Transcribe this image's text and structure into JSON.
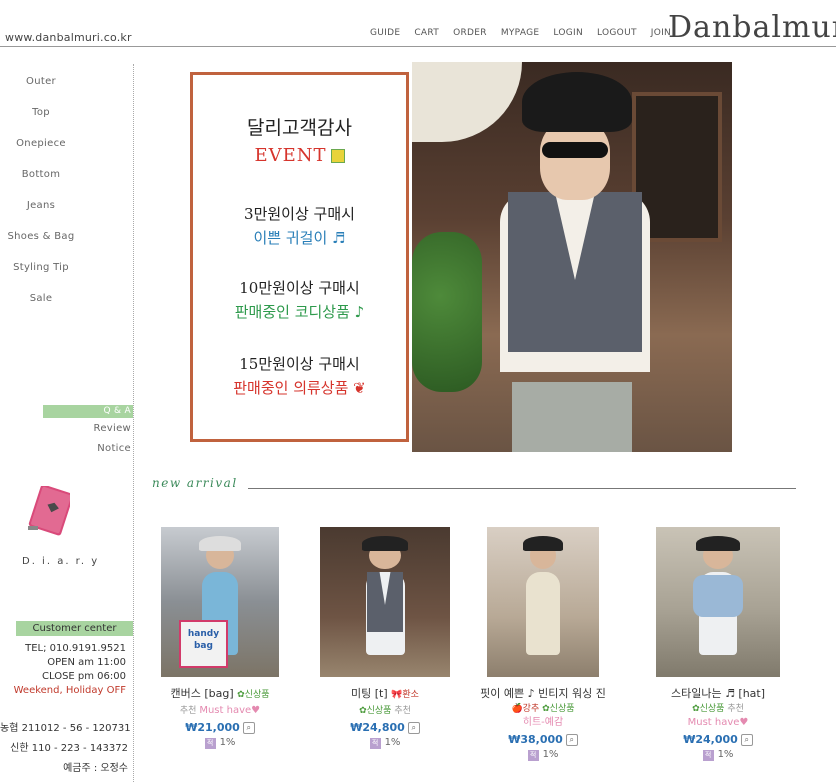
{
  "header": {
    "site_url": "www.danbalmuri.co.kr",
    "logo": "Danbalmuri",
    "nav": [
      "GUIDE",
      "CART",
      "ORDER",
      "MYPAGE",
      "LOGIN",
      "LOGOUT",
      "JOIN"
    ]
  },
  "sidebar": {
    "categories": [
      "Outer",
      "Top",
      "Onepiece",
      "Bottom",
      "Jeans",
      "Shoes & Bag",
      "Styling Tip",
      "Sale"
    ],
    "board": [
      "Q & A",
      "Review",
      "Notice"
    ],
    "diary_label": "D. i. a. r. y",
    "customer_center": {
      "title": "Customer center",
      "tel": "TEL; 010.9191.9521",
      "open": "OPEN am 11:00",
      "close": "CLOSE pm 06:00",
      "holiday": "Weekend, Holiday OFF"
    },
    "bank": {
      "line1": "농협 211012 - 56 - 120731",
      "line2": "신한 110 - 223 - 143372",
      "holder": "예금주 : 오정수"
    }
  },
  "event": {
    "title": "달리고객감사",
    "event": "EVENT",
    "tier1": "3만원이상 구매시",
    "gift1": "이쁜 귀걸이 ♬",
    "tier2": "10만원이상 구매시",
    "gift2": "판매중인 코디상품 ♪",
    "tier3": "15만원이상 구매시",
    "gift3": "판매중인 의류상품 ❦"
  },
  "new_arrival": {
    "title": "new arrival",
    "products": [
      {
        "name": "캔버스 [bag]",
        "tag1": "✿신상품",
        "tag2": "추천",
        "tag3": "Must have♥",
        "price": "₩21,000",
        "point": "1%"
      },
      {
        "name": "미팅 [t]",
        "tag_bow": "🎀환소",
        "tag1": "✿신상품",
        "tag2": "추천",
        "price": "₩24,800",
        "point": "1%"
      },
      {
        "name": "핏이 예쁜 ♪ 빈티지 워싱 진",
        "tag_bow": "🍎강추",
        "tag1": "✿신상품",
        "tag2": "히트-예감",
        "price": "₩38,000",
        "point": "1%"
      },
      {
        "name": "스타일나는 ♬ [hat]",
        "tag1": "✿신상품",
        "tag2": "추천",
        "tag3": "Must have♥",
        "price": "₩24,000",
        "point": "1%"
      }
    ]
  },
  "icons": {
    "zoom": "🔍",
    "point_badge": "적"
  }
}
